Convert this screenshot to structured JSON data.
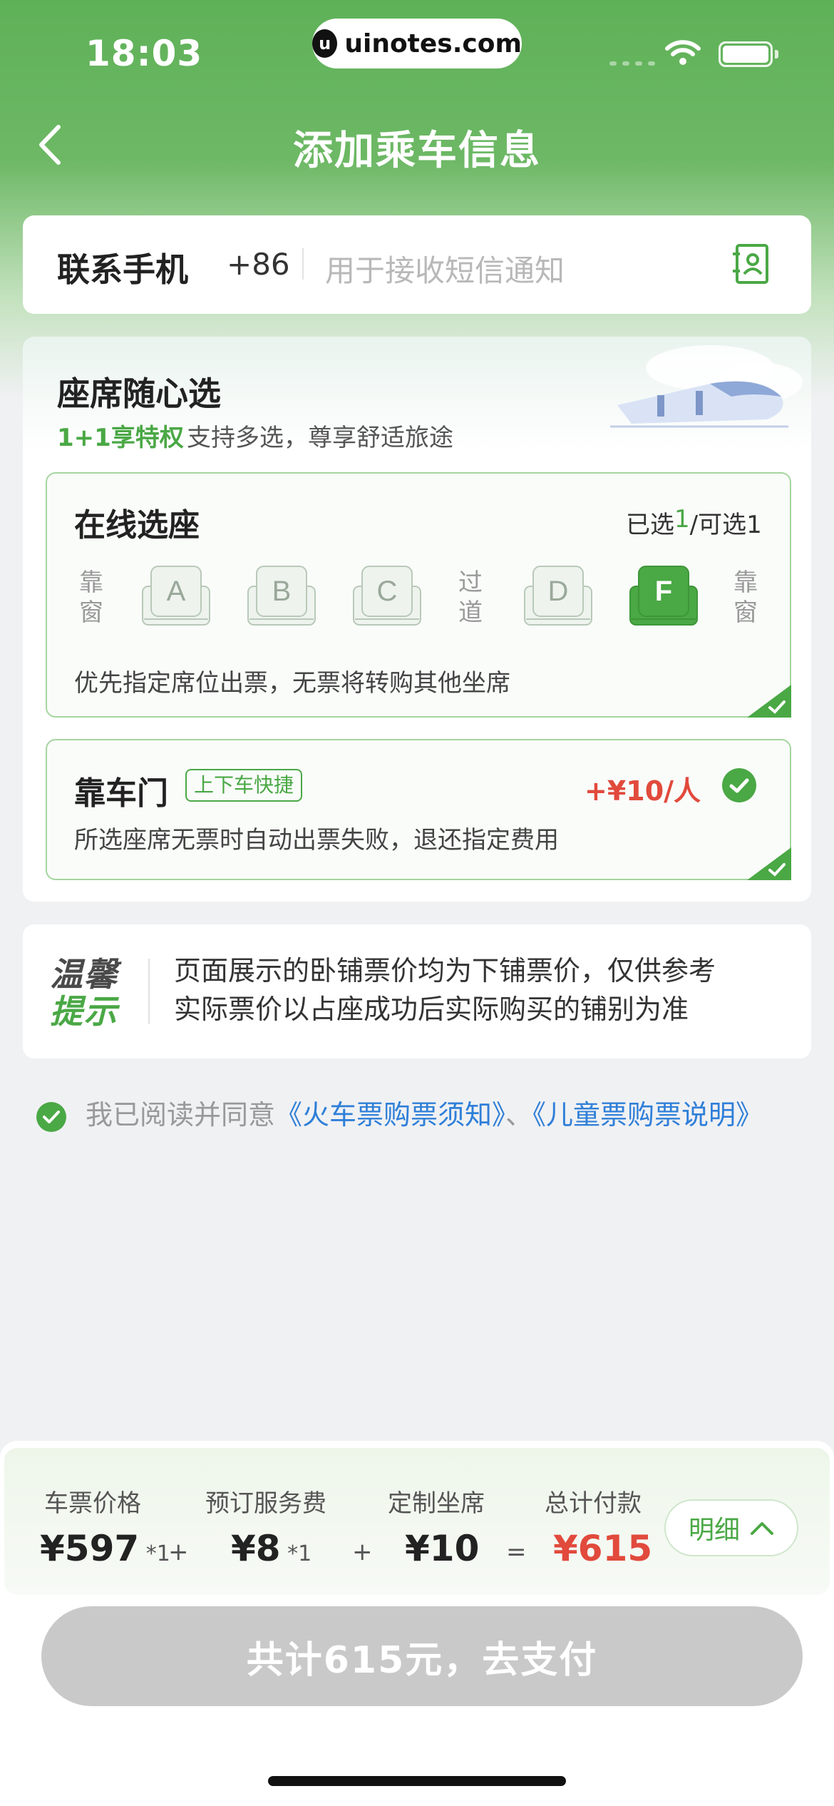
{
  "status_bar": {
    "time": "18:03",
    "url": "uinotes.com",
    "url_logo": "u"
  },
  "nav": {
    "title": "添加乘车信息"
  },
  "phone": {
    "label": "联系手机",
    "country_code": "+86",
    "placeholder": "用于接收短信通知"
  },
  "seat_section": {
    "title": "座席随心选",
    "privilege": "1+1享特权",
    "subtitle": "支持多选，尊享舒适旅途",
    "online": {
      "title": "在线选座",
      "count_prefix": "已选",
      "selected": "1",
      "count_suffix": "/可选1",
      "window_left": "靠窗",
      "aisle": "过道",
      "window_right": "靠窗",
      "seats": [
        {
          "letter": "A",
          "selected": false
        },
        {
          "letter": "B",
          "selected": false
        },
        {
          "letter": "C",
          "selected": false
        },
        {
          "letter": "D",
          "selected": false
        },
        {
          "letter": "F",
          "selected": true
        }
      ],
      "hint": "优先指定席位出票，无票将转购其他坐席"
    },
    "door": {
      "title": "靠车门",
      "tag": "上下车快捷",
      "price": "+¥10/人",
      "desc": "所选座席无票时自动出票失败，退还指定费用"
    }
  },
  "tips": {
    "logo_line1": "温馨",
    "logo_line2": "提示",
    "line1": "页面展示的卧铺票价均为下铺票价，仅供参考",
    "line2": "实际票价以占座成功后实际购买的铺别为准"
  },
  "agreement": {
    "prefix": "我已阅读并同意",
    "link1": "《火车票购票须知》",
    "sep": "、",
    "link2": "《儿童票购票说明》"
  },
  "fees": {
    "ticket_label": "车票价格",
    "ticket_value": "¥597",
    "ticket_mult": "*1",
    "service_label": "预订服务费",
    "service_value": "¥8",
    "service_mult": "*1",
    "seat_label": "定制坐席",
    "seat_value": "¥10",
    "total_label": "总计付款",
    "total_value": "¥615",
    "plus": "+",
    "equals": "=",
    "detail_label": "明细"
  },
  "pay_button": "共计615元，去支付",
  "colors": {
    "brand_green": "#4aa845",
    "price_red": "#e14a3c",
    "link_blue": "#2f7fd8"
  }
}
